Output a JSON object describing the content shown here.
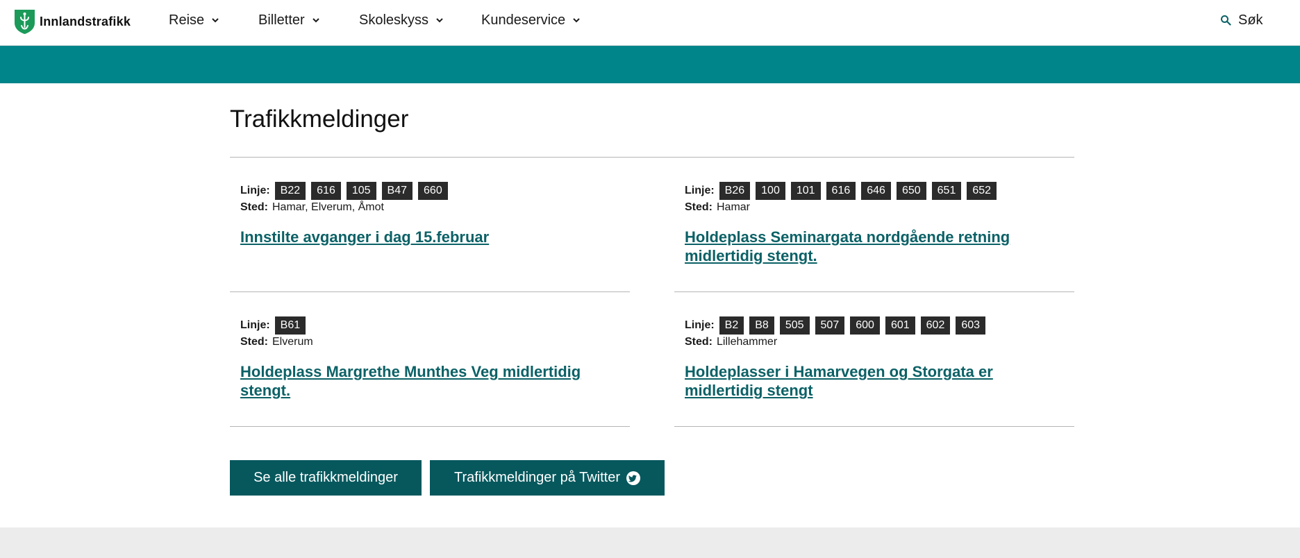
{
  "header": {
    "brand": "Innlandstrafikk",
    "nav": [
      {
        "label": "Reise"
      },
      {
        "label": "Billetter"
      },
      {
        "label": "Skoleskyss"
      },
      {
        "label": "Kundeservice"
      }
    ],
    "search_label": "Søk"
  },
  "main": {
    "title": "Trafikkmeldinger",
    "line_label": "Linje:",
    "place_label": "Sted:",
    "messages": [
      {
        "lines": [
          "B22",
          "616",
          "105",
          "B47",
          "660"
        ],
        "place": "Hamar, Elverum, Åmot",
        "title": "Innstilte avganger i dag 15.februar"
      },
      {
        "lines": [
          "B26",
          "100",
          "101",
          "616",
          "646",
          "650",
          "651",
          "652"
        ],
        "place": "Hamar",
        "title": "Holdeplass Seminargata nordgående retning midlertidig stengt."
      },
      {
        "lines": [
          "B61"
        ],
        "place": "Elverum",
        "title": "Holdeplass Margrethe Munthes Veg midlertidig stengt."
      },
      {
        "lines": [
          "B2",
          "B8",
          "505",
          "507",
          "600",
          "601",
          "602",
          "603"
        ],
        "place": "Lillehammer",
        "title": "Holdeplasser i Hamarvegen og Storgata er midlertidig stengt"
      }
    ],
    "buttons": {
      "all_label": "Se alle trafikkmeldinger",
      "twitter_label": "Trafikkmeldinger på Twitter"
    }
  },
  "colors": {
    "brand_green": "#1b9a5a",
    "band_teal": "#00858a",
    "link_teal": "#0b6166",
    "button_teal": "#06585d",
    "badge_bg": "#2b2b2b"
  }
}
